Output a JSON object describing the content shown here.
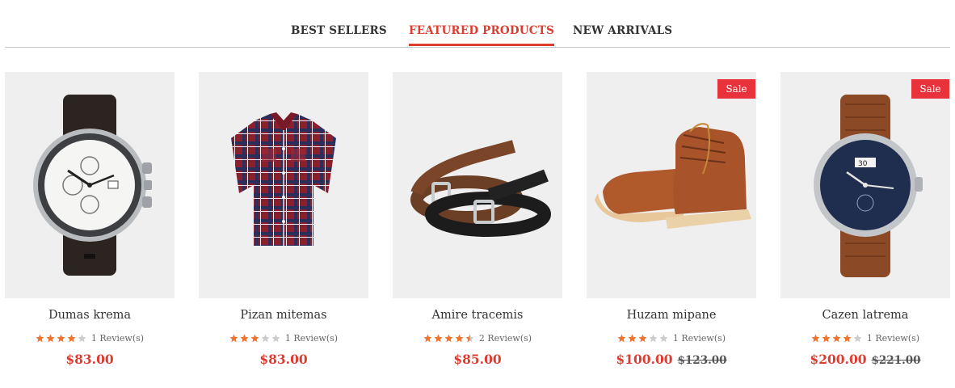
{
  "tabs": [
    {
      "label": "BEST SELLERS"
    },
    {
      "label": "FEATURED PRODUCTS"
    },
    {
      "label": "NEW ARRIVALS"
    }
  ],
  "colors": {
    "accent": "#df3c30",
    "sale_badge": "#e8333d",
    "star_on": "#f0722e",
    "star_off": "#cccccc"
  },
  "products": [
    {
      "name": "Dumas krema",
      "image": "watch-steel-icon",
      "stars": 4,
      "reviews": "1 Review(s)",
      "price": "$83.00",
      "old_price": "",
      "badge": ""
    },
    {
      "name": "Pizan mitemas",
      "image": "plaid-shirt-icon",
      "stars": 3,
      "reviews": "1 Review(s)",
      "price": "$83.00",
      "old_price": "",
      "badge": ""
    },
    {
      "name": "Amire tracemis",
      "image": "belts-icon",
      "stars": 4.5,
      "reviews": "2 Review(s)",
      "price": "$85.00",
      "old_price": "",
      "badge": ""
    },
    {
      "name": "Huzam mipane",
      "image": "boot-icon",
      "stars": 3,
      "reviews": "1 Review(s)",
      "price": "$100.00",
      "old_price": "$123.00",
      "badge": "Sale"
    },
    {
      "name": "Cazen latrema",
      "image": "watch-blue-icon",
      "stars": 4,
      "reviews": "1 Review(s)",
      "price": "$200.00",
      "old_price": "$221.00",
      "badge": "Sale"
    }
  ]
}
